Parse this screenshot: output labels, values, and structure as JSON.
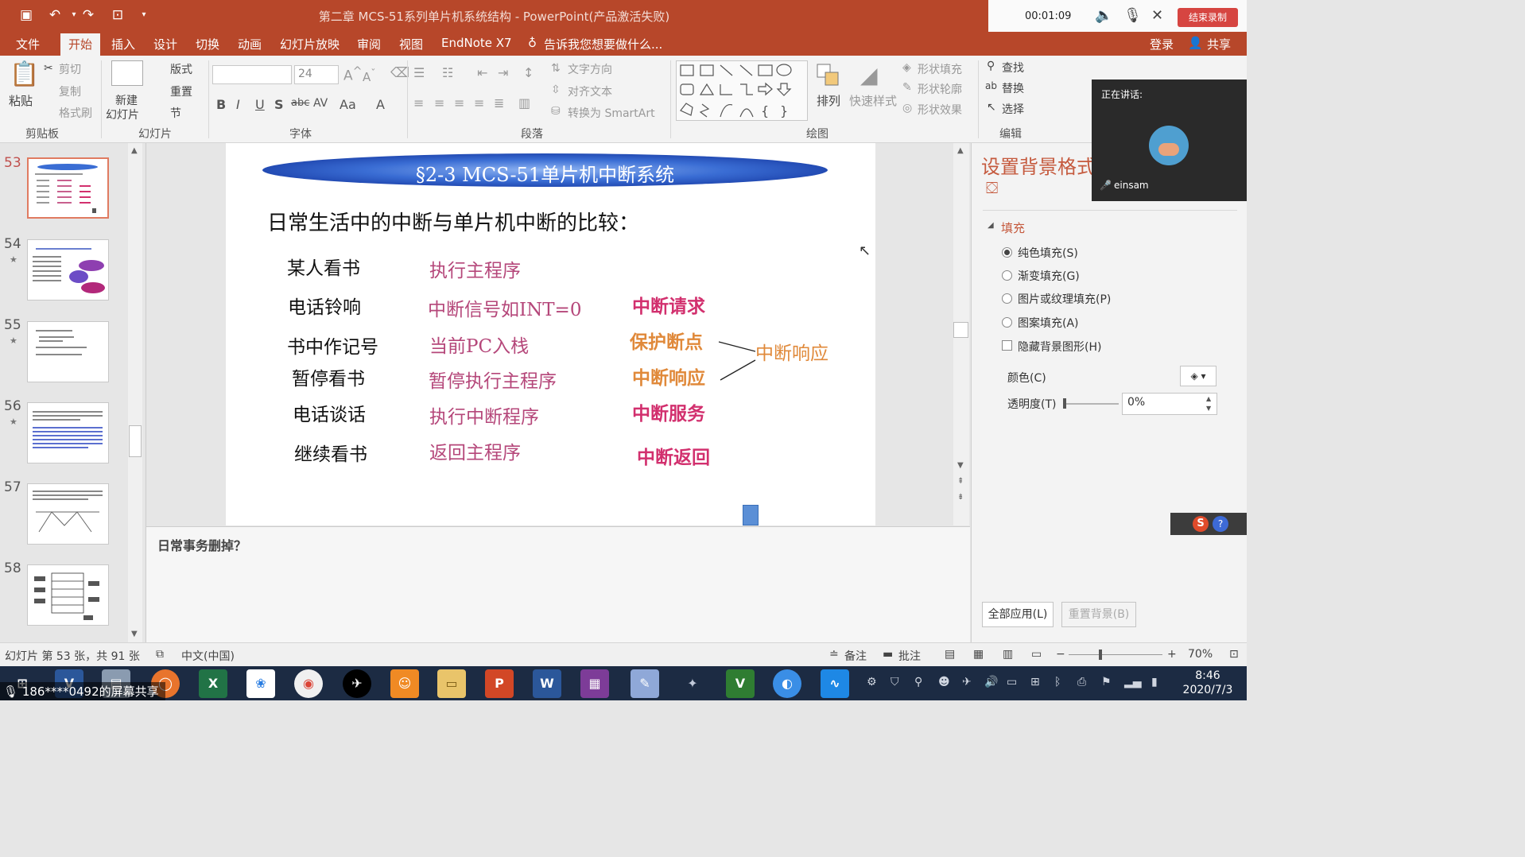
{
  "window": {
    "title": "第二章 MCS-51系列单片机系统结构 - PowerPoint(产品激活失败)"
  },
  "recording": {
    "timer": "00:01:09",
    "stop_label": "结束录制"
  },
  "menu": {
    "tabs": [
      "文件",
      "开始",
      "插入",
      "设计",
      "切换",
      "动画",
      "幻灯片放映",
      "审阅",
      "视图",
      "EndNote X7"
    ],
    "active": "开始",
    "tellme": "告诉我您想要做什么...",
    "login": "登录",
    "share": "共享"
  },
  "ribbon": {
    "clipboard": {
      "paste": "粘贴",
      "cut": "剪切",
      "copy": "复制",
      "format_painter": "格式刷",
      "group": "剪贴板"
    },
    "slides": {
      "new_slide_1": "新建",
      "new_slide_2": "幻灯片",
      "layout": "版式",
      "reset": "重置",
      "section": "节",
      "group": "幻灯片"
    },
    "font": {
      "size": "24",
      "group": "字体",
      "bold": "B",
      "italic": "I",
      "underline": "U",
      "shadow": "S",
      "strike": "abc",
      "spacing": "AV",
      "case": "Aa",
      "color": "A"
    },
    "paragraph": {
      "text_direction": "文字方向",
      "align_text": "对齐文本",
      "smartart": "转换为 SmartArt",
      "group": "段落"
    },
    "drawing": {
      "arrange": "排列",
      "quick_styles": "快速样式",
      "shape_fill": "形状填充",
      "shape_outline": "形状轮廓",
      "shape_effects": "形状效果",
      "group": "绘图"
    },
    "editing": {
      "find": "查找",
      "replace": "替换",
      "select": "选择",
      "group": "编辑"
    }
  },
  "thumbnails": [
    {
      "num": "53",
      "star": false,
      "selected": true
    },
    {
      "num": "54",
      "star": true,
      "selected": false
    },
    {
      "num": "55",
      "star": true,
      "selected": false
    },
    {
      "num": "56",
      "star": true,
      "selected": false
    },
    {
      "num": "57",
      "star": false,
      "selected": false
    },
    {
      "num": "58",
      "star": false,
      "selected": false
    }
  ],
  "slide": {
    "banner": "§2-3 MCS-51单片机中断系统",
    "heading": "日常生活中的中断与单片机中断的比较：",
    "rows": [
      {
        "left": "某人看书",
        "mid": "执行主程序",
        "right": ""
      },
      {
        "left": "电话铃响",
        "mid": "中断信号如INT=0",
        "right": "中断请求"
      },
      {
        "left": "书中作记号",
        "mid": "当前PC入栈",
        "right": "保护断点"
      },
      {
        "left": "暂停看书",
        "mid": "暂停执行主程序",
        "right": "中断响应"
      },
      {
        "left": "电话谈话",
        "mid": "执行中断程序",
        "right": "中断服务"
      },
      {
        "left": "继续看书",
        "mid": "返回主程序",
        "right": "中断返回"
      }
    ],
    "bracket_label": "中断响应"
  },
  "notes": {
    "text": "日常事务删掉？"
  },
  "pane": {
    "title": "设置背景格式",
    "section": "填充",
    "options": [
      {
        "label": "纯色填充(S)",
        "checked": true
      },
      {
        "label": "渐变填充(G)",
        "checked": false
      },
      {
        "label": "图片或纹理填充(P)",
        "checked": false
      },
      {
        "label": "图案填充(A)",
        "checked": false
      }
    ],
    "hide_bg": "隐藏背景图形(H)",
    "color_label": "颜色(C)",
    "transparency_label": "透明度(T)",
    "transparency_value": "0%",
    "apply_all": "全部应用(L)",
    "reset_bg": "重置背景(B)"
  },
  "speaker": {
    "label": "正在讲话:",
    "name": "einsam"
  },
  "status": {
    "slide_info": "幻灯片 第 53 张，共 91 张",
    "language": "中文(中国)",
    "notes": "备注",
    "comments": "批注",
    "zoom": "70%"
  },
  "taskbar": {
    "share_text": "186****0492的屏幕共享",
    "time": "8:46",
    "date": "2020/7/3"
  },
  "colors": {
    "accent": "#b7472a",
    "taskbar": "#1c2b43"
  }
}
